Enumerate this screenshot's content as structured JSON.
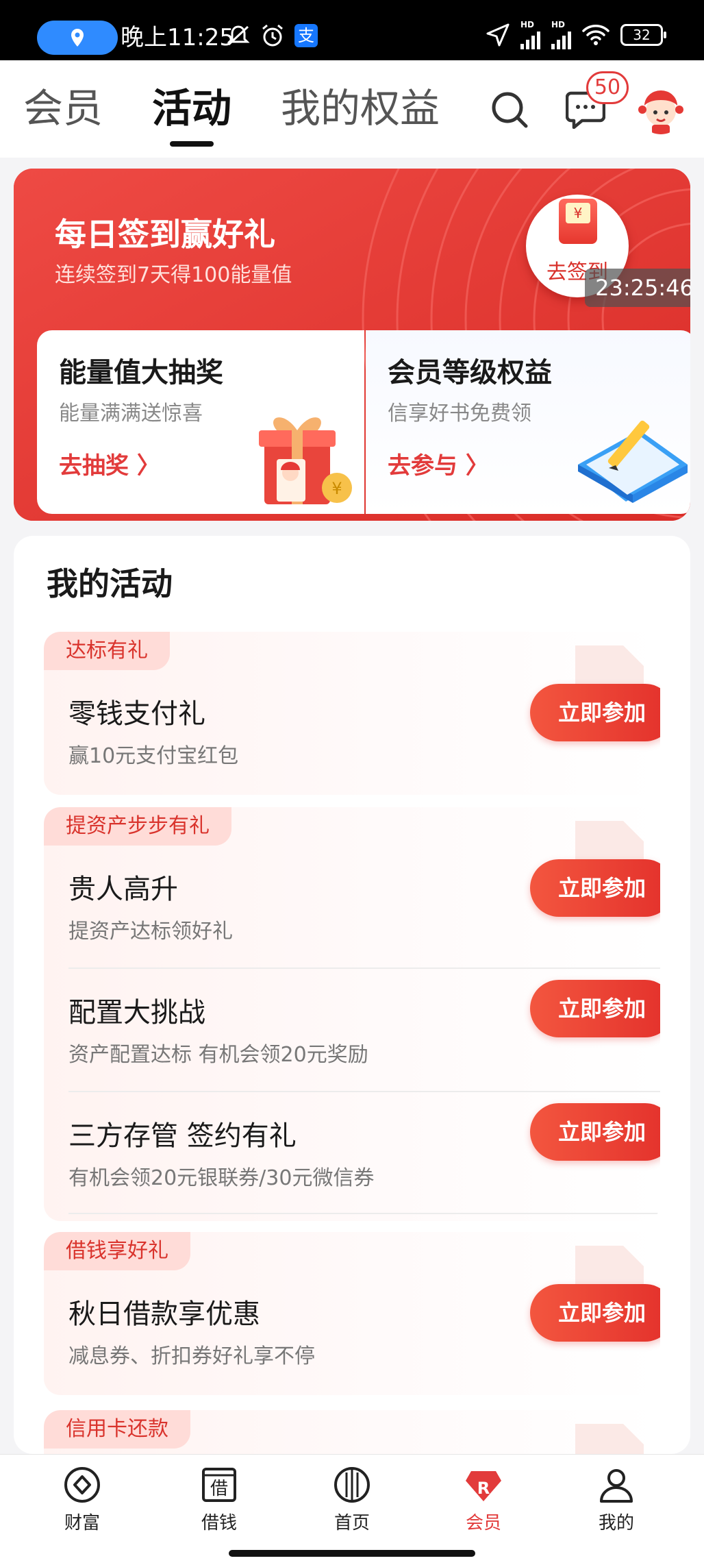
{
  "status_bar": {
    "time": "晚上11:25",
    "pay_icon": "支",
    "battery": "32"
  },
  "top_nav": {
    "tabs": [
      {
        "label": "会员"
      },
      {
        "label": "活动"
      },
      {
        "label": "我的权益"
      }
    ],
    "message_badge": "50"
  },
  "signin": {
    "title": "每日签到赢好礼",
    "subtitle": "连续签到7天得100能量值",
    "button_label": "去签到",
    "envelope_symbol": "¥",
    "overlay_time": "23:25:46"
  },
  "cards": {
    "lottery": {
      "title": "能量值大抽奖",
      "desc": "能量满满送惊喜",
      "link": "去抽奖 〉"
    },
    "level": {
      "title": "会员等级权益",
      "desc": "信享好书免费领",
      "link": "去参与 〉"
    }
  },
  "activities": {
    "title": "我的活动",
    "groups": [
      {
        "tag": "达标有礼",
        "items": [
          {
            "title": "零钱支付礼",
            "desc": "赢10元支付宝红包",
            "button": "立即参加"
          }
        ]
      },
      {
        "tag": "提资产步步有礼",
        "items": [
          {
            "title": "贵人高升",
            "desc": "提资产达标领好礼",
            "button": "立即参加"
          },
          {
            "title": "配置大挑战",
            "desc": "资产配置达标 有机会领20元奖励",
            "button": "立即参加"
          },
          {
            "title": "三方存管 签约有礼",
            "desc": "有机会领20元银联券/30元微信券",
            "button": "立即参加"
          }
        ]
      },
      {
        "tag": "借钱享好礼",
        "items": [
          {
            "title": "秋日借款享优惠",
            "desc": "减息券、折扣券好礼享不停",
            "button": "立即参加"
          }
        ]
      },
      {
        "tag": "信用卡还款",
        "items": []
      }
    ]
  },
  "bottom_nav": [
    {
      "label": "财富",
      "icon": "wealth-icon"
    },
    {
      "label": "借钱",
      "icon": "borrow-icon",
      "glyph": "借"
    },
    {
      "label": "首页",
      "icon": "home-icon"
    },
    {
      "label": "会员",
      "icon": "member-icon",
      "glyph": "R"
    },
    {
      "label": "我的",
      "icon": "profile-icon"
    }
  ],
  "colors": {
    "accent": "#e23b3b",
    "card_red": "#e53935",
    "tag_bg": "#ffdcd8"
  }
}
